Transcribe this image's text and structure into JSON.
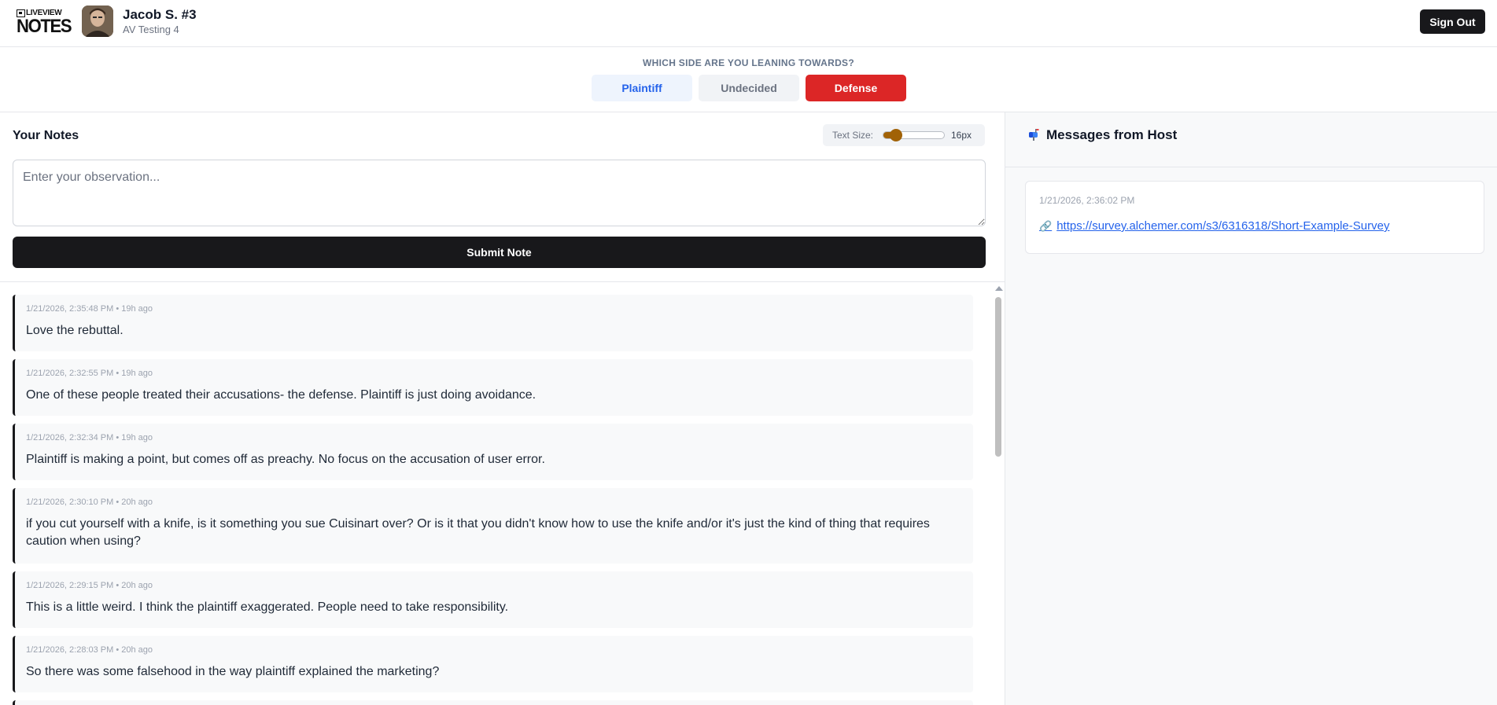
{
  "header": {
    "logo_top": "LIVEVIEW",
    "logo_bottom": "NOTES",
    "user_name": "Jacob S. #3",
    "session": "AV Testing 4",
    "sign_out_label": "Sign Out"
  },
  "lean": {
    "question": "WHICH SIDE ARE YOU LEANING TOWARDS?",
    "options": [
      "Plaintiff",
      "Undecided",
      "Defense"
    ],
    "selected": "Defense"
  },
  "notes": {
    "title": "Your Notes",
    "text_size_label": "Text Size:",
    "text_size_value": "16px",
    "text_size_level": 0.15,
    "input_placeholder": "Enter your observation...",
    "input_value": "",
    "submit_label": "Submit Note",
    "items": [
      {
        "meta": "1/21/2026, 2:35:48 PM • 19h ago",
        "text": "Love the rebuttal."
      },
      {
        "meta": "1/21/2026, 2:32:55 PM • 19h ago",
        "text": "One of these people treated their accusations- the defense. Plaintiff is just doing avoidance."
      },
      {
        "meta": "1/21/2026, 2:32:34 PM • 19h ago",
        "text": "Plaintiff is making a point, but comes off as preachy. No focus on the accusation of user error."
      },
      {
        "meta": "1/21/2026, 2:30:10 PM • 20h ago",
        "text": "if you cut yourself with a knife, is it something you sue Cuisinart over? Or is it that you didn't know how to use the knife and/or it's just the kind of thing that requires caution when using?"
      },
      {
        "meta": "1/21/2026, 2:29:15 PM • 20h ago",
        "text": "This is a little weird. I think the plaintiff exaggerated. People need to take responsibility."
      },
      {
        "meta": "1/21/2026, 2:28:03 PM • 20h ago",
        "text": "So there was some falsehood in the way plaintiff explained the marketing?"
      }
    ]
  },
  "messages": {
    "title": "Messages from Host",
    "items": [
      {
        "time": "1/21/2026, 2:36:02 PM",
        "link": "https://survey.alchemer.com/s3/6316318/Short-Example-Survey"
      }
    ]
  },
  "colors": {
    "accent_dark": "#18181b",
    "defense": "#dc2626",
    "plaintiff_text": "#2563eb",
    "slider": "#a16207"
  },
  "icons": {
    "message_header": "mailbox-icon",
    "message_link": "link-icon"
  }
}
